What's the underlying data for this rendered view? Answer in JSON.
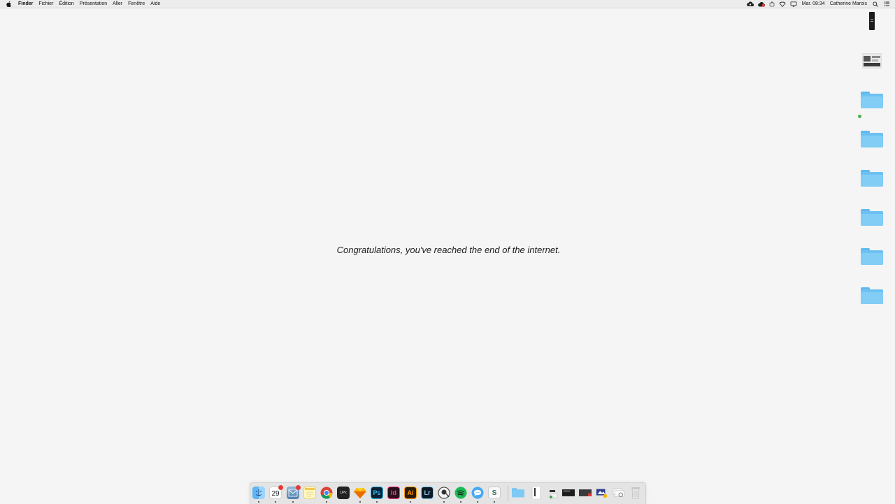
{
  "menubar": {
    "items": [
      "Finder",
      "Fichier",
      "Édition",
      "Présentation",
      "Aller",
      "Fenêtre",
      "Aide"
    ],
    "clock": "Mar. 08:34",
    "user": "Catherine Marois",
    "status_icons": [
      "cloud-icon",
      "creative-cloud-icon",
      "extension-icon",
      "hotspot-icon",
      "airplay-icon",
      "search-icon",
      "list-icon"
    ]
  },
  "message": "Congratulations, you've reached the end of the internet.",
  "desktop": {
    "icons": [
      {
        "type": "file",
        "label": ""
      },
      {
        "type": "image",
        "label": ""
      },
      {
        "type": "folder",
        "label": "",
        "tag_color": "#4caf50"
      },
      {
        "type": "folder",
        "label": ""
      },
      {
        "type": "folder",
        "label": ""
      },
      {
        "type": "folder",
        "label": ""
      },
      {
        "type": "folder",
        "label": ""
      },
      {
        "type": "folder",
        "label": ""
      }
    ]
  },
  "dock": {
    "calendar_day": "29",
    "apps": [
      "finder",
      "calendar",
      "mail",
      "notes",
      "chrome",
      "terminal",
      "sketch",
      "photoshop",
      "indesign",
      "illustrator",
      "lightroom",
      "cyberduck",
      "spotify",
      "messages",
      "slack"
    ],
    "app_labels": {
      "terminal": "UPx",
      "photoshop": "Ps",
      "indesign": "Id",
      "illustrator": "Ai",
      "lightroom": "Lr",
      "slack": "S"
    }
  },
  "colors": {
    "desktop_bg": "#f5f5f5",
    "folder": "#6dc1f2",
    "photoshop_bg": "#0b2230",
    "photoshop_fg": "#35b9f3",
    "indesign_bg": "#2a0f1c",
    "indesign_fg": "#ff3b8a",
    "illustrator_bg": "#2b1a05",
    "illustrator_fg": "#ff9a00",
    "lightroom_bg": "#0d1a25",
    "lightroom_fg": "#83c8f0",
    "spotify": "#1db954"
  }
}
